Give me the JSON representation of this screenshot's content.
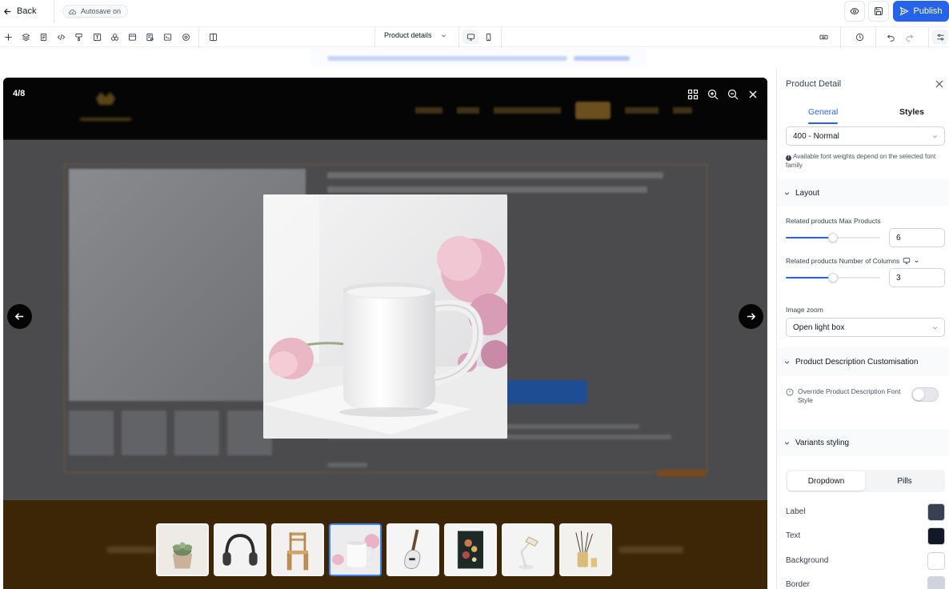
{
  "topbar": {
    "back_label": "Back",
    "autosave_label": "Autosave on",
    "publish_label": "Publish"
  },
  "toolbar": {
    "page_select_label": "Product details",
    "tools": [
      "add-icon",
      "layers-icon",
      "page-icon",
      "code-icon",
      "paint-icon",
      "text-icon",
      "shapes-icon",
      "section-icon",
      "form-icon",
      "terminal-icon",
      "settings-icon",
      "split-view-icon"
    ]
  },
  "lightbox": {
    "counter": "4/8",
    "thumbnails": [
      {
        "name": "succulent-plant-thumb",
        "active": false
      },
      {
        "name": "headphones-thumb",
        "active": false
      },
      {
        "name": "wooden-chair-thumb",
        "active": false
      },
      {
        "name": "white-mug-thumb",
        "active": true
      },
      {
        "name": "electric-guitar-thumb",
        "active": false
      },
      {
        "name": "floral-notebook-thumb",
        "active": false
      },
      {
        "name": "desk-lamp-thumb",
        "active": false
      },
      {
        "name": "reed-diffuser-thumb",
        "active": false
      }
    ]
  },
  "panel": {
    "title": "Product Detail",
    "tabs": [
      {
        "label": "General",
        "active": true
      },
      {
        "label": "Styles",
        "active": false
      }
    ],
    "font_weight_value": "400 - Normal",
    "font_weight_note": "Available font weights depend on the selected font family",
    "sections": {
      "layout": "Layout",
      "description": "Product Description Customisation",
      "variants": "Variants styling"
    },
    "max_products": {
      "label": "Related products Max Products",
      "value": "6",
      "fill": 0.5
    },
    "num_columns": {
      "label": "Related products Number of Columns",
      "value": "3",
      "fill": 0.5
    },
    "image_zoom": {
      "label": "Image zoom",
      "value": "Open light box"
    },
    "override_label": "Override Product Description Font Style",
    "override_enabled": false,
    "variant_options": [
      {
        "label": "Dropdown",
        "active": true
      },
      {
        "label": "Pills",
        "active": false
      }
    ],
    "colors": [
      {
        "label": "Label",
        "color": "#374151"
      },
      {
        "label": "Text",
        "color": "#111827"
      },
      {
        "label": "Background",
        "color": "#ffffff"
      },
      {
        "label": "Border",
        "color": "#d1d5db"
      }
    ]
  },
  "theme": {
    "accent": "#2563eb",
    "footer": "#3c2606"
  }
}
